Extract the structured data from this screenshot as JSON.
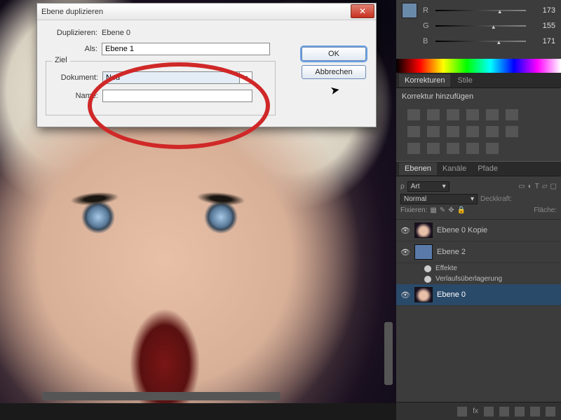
{
  "dialog": {
    "title": "Ebene duplizieren",
    "dup_label": "Duplizieren:",
    "dup_value": "Ebene 0",
    "as_label": "Als:",
    "as_value": "Ebene 1",
    "dest_legend": "Ziel",
    "doc_label": "Dokument:",
    "doc_value": "Neu",
    "name_label": "Name:",
    "name_value": "",
    "ok": "OK",
    "cancel": "Abbrechen",
    "close_glyph": "✕"
  },
  "color": {
    "r_label": "R",
    "r_value": "173",
    "g_label": "G",
    "g_value": "155",
    "b_label": "B",
    "b_value": "171"
  },
  "corrections": {
    "tab1": "Korrekturen",
    "tab2": "Stile",
    "heading": "Korrektur hinzufügen"
  },
  "layers": {
    "tab1": "Ebenen",
    "tab2": "Kanäle",
    "tab3": "Pfade",
    "filter_label": "ρ",
    "filter_value": "Art",
    "blend_value": "Normal",
    "opacity_label": "Deckkraft:",
    "lock_label": "Fixieren:",
    "fill_label": "Fläche:",
    "items": [
      {
        "name": "Ebene 0 Kopie"
      },
      {
        "name": "Ebene 2"
      },
      {
        "name": "Ebene 0"
      }
    ],
    "fx_label": "Effekte",
    "fx_item": "Verlaufsüberlagerung"
  },
  "footer": {
    "fx": "fx"
  }
}
